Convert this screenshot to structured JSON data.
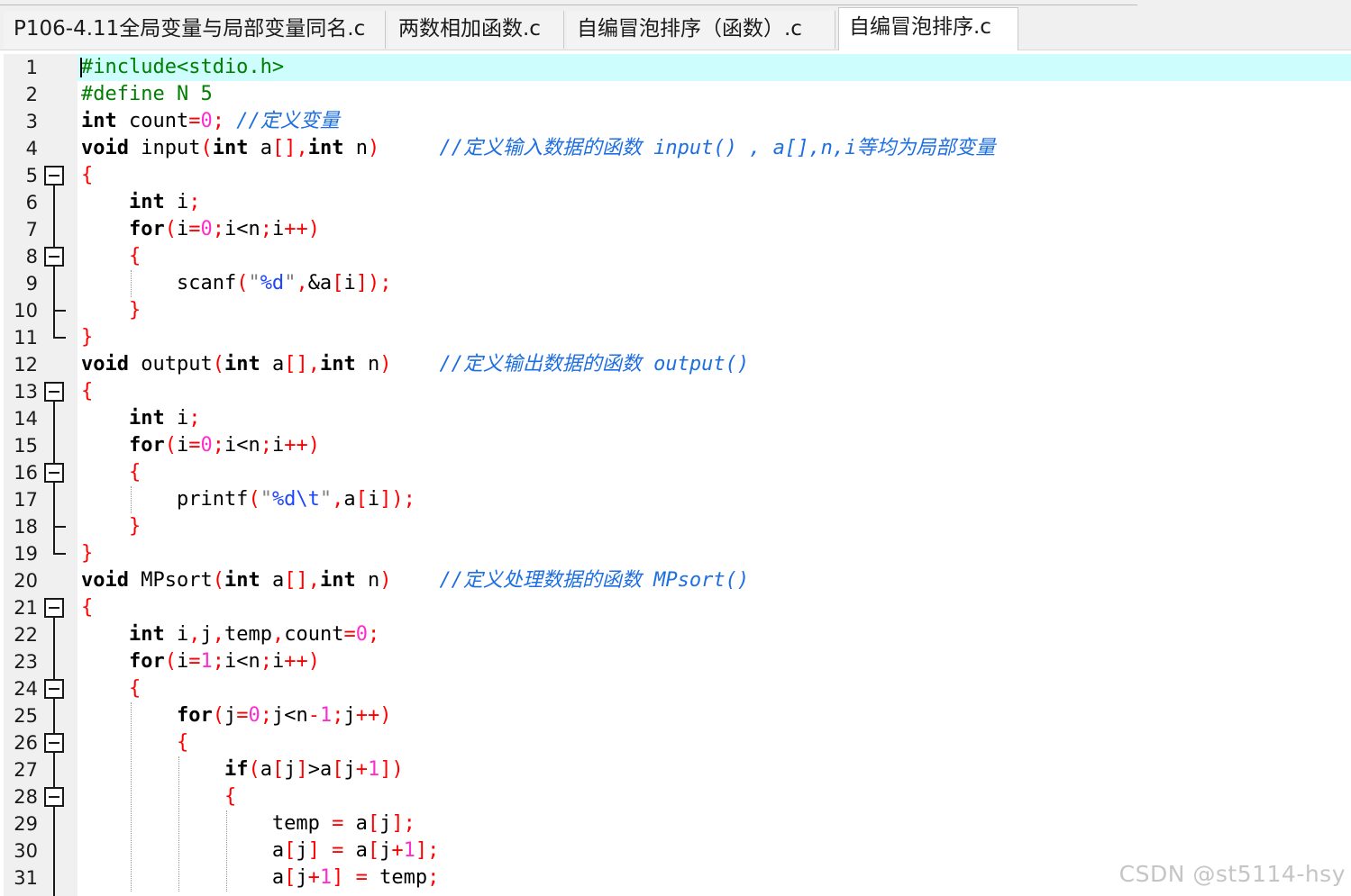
{
  "tabs": [
    {
      "label": "P106-4.11全局变量与局部变量同名.c",
      "active": false
    },
    {
      "label": "两数相加函数.c",
      "active": false
    },
    {
      "label": "自编冒泡排序（函数）.c",
      "active": false
    },
    {
      "label": "自编冒泡排序.c",
      "active": true
    }
  ],
  "editor": {
    "current_line": 1,
    "lines": [
      {
        "n": "1",
        "code": "#include<stdio.h>"
      },
      {
        "n": "2",
        "code": "#define N 5"
      },
      {
        "n": "3",
        "code": "int count=0; //定义变量"
      },
      {
        "n": "4",
        "code": "void input(int a[],int n)     //定义输入数据的函数 input() , a[],n,i等均为局部变量"
      },
      {
        "n": "5",
        "code": "{"
      },
      {
        "n": "6",
        "code": "    int i;"
      },
      {
        "n": "7",
        "code": "    for(i=0;i<n;i++)"
      },
      {
        "n": "8",
        "code": "    {"
      },
      {
        "n": "9",
        "code": "        scanf(\"%d\",&a[i]);"
      },
      {
        "n": "10",
        "code": "    }"
      },
      {
        "n": "11",
        "code": "}"
      },
      {
        "n": "12",
        "code": "void output(int a[],int n)    //定义输出数据的函数 output()"
      },
      {
        "n": "13",
        "code": "{"
      },
      {
        "n": "14",
        "code": "    int i;"
      },
      {
        "n": "15",
        "code": "    for(i=0;i<n;i++)"
      },
      {
        "n": "16",
        "code": "    {"
      },
      {
        "n": "17",
        "code": "        printf(\"%d\\t\",a[i]);"
      },
      {
        "n": "18",
        "code": "    }"
      },
      {
        "n": "19",
        "code": "}"
      },
      {
        "n": "20",
        "code": "void MPsort(int a[],int n)    //定义处理数据的函数 MPsort()"
      },
      {
        "n": "21",
        "code": "{"
      },
      {
        "n": "22",
        "code": "    int i,j,temp,count=0;"
      },
      {
        "n": "23",
        "code": "    for(i=1;i<n;i++)"
      },
      {
        "n": "24",
        "code": "    {"
      },
      {
        "n": "25",
        "code": "        for(j=0;j<n-1;j++)"
      },
      {
        "n": "26",
        "code": "        {"
      },
      {
        "n": "27",
        "code": "            if(a[j]>a[j+1])"
      },
      {
        "n": "28",
        "code": "            {"
      },
      {
        "n": "29",
        "code": "                temp = a[j];"
      },
      {
        "n": "30",
        "code": "                a[j] = a[j+1];"
      },
      {
        "n": "31",
        "code": "                a[j+1] = temp;"
      }
    ]
  },
  "watermark": "CSDN @st5114-hsy",
  "colors": {
    "current_line_bg": "#cdfdfd",
    "keyword": "#000000",
    "number": "#ff2dd0",
    "operator": "#ff0000",
    "preprocessor": "#008000",
    "string": "#808080",
    "comment": "#1e6fe0"
  }
}
